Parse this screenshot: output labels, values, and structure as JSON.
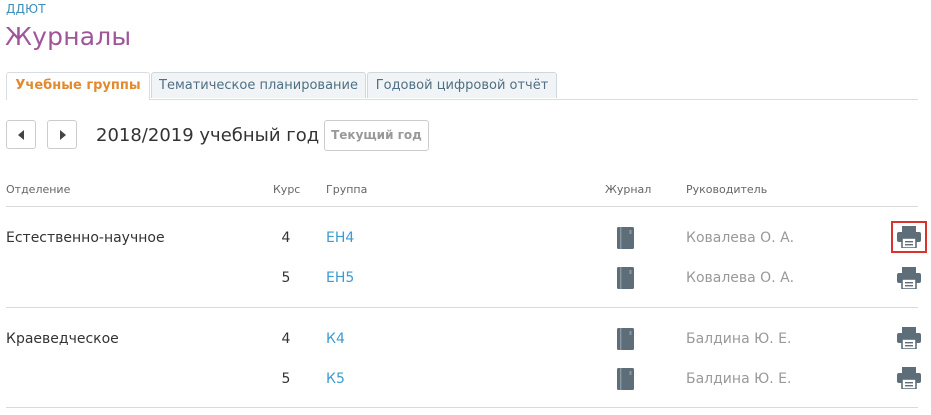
{
  "breadcrumb": "ДДЮТ",
  "page_title": "Журналы",
  "tabs": [
    {
      "label": "Учебные группы",
      "active": true
    },
    {
      "label": "Тематическое планирование",
      "active": false
    },
    {
      "label": "Годовой цифровой отчёт",
      "active": false
    }
  ],
  "year_bar": {
    "year_label": "2018/2019 учебный год",
    "current_year_button": "Текущий год",
    "prev_icon": "triangle-left-icon",
    "next_icon": "triangle-right-icon"
  },
  "table": {
    "headers": {
      "department": "Отделение",
      "course": "Курс",
      "group": "Группа",
      "journal": "Журнал",
      "leader": "Руководитель"
    },
    "sections": [
      {
        "department": "Естественно-научное",
        "rows": [
          {
            "course": "4",
            "group": "ЕН4",
            "leader": "Ковалева О. А.",
            "print_highlighted": true
          },
          {
            "course": "5",
            "group": "ЕН5",
            "leader": "Ковалева О. А.",
            "print_highlighted": false
          }
        ]
      },
      {
        "department": "Краеведческое",
        "rows": [
          {
            "course": "4",
            "group": "К4",
            "leader": "Балдина Ю. Е.",
            "print_highlighted": false
          },
          {
            "course": "5",
            "group": "К5",
            "leader": "Балдина Ю. Е.",
            "print_highlighted": false
          }
        ]
      }
    ]
  },
  "icons": {
    "journal": "journal-book-icon",
    "print": "printer-icon"
  },
  "colors": {
    "title": "#a0559b",
    "link": "#3d9ccf",
    "active_tab": "#e28a2f",
    "icon": "#5e6e79",
    "highlight": "#d9342b"
  }
}
